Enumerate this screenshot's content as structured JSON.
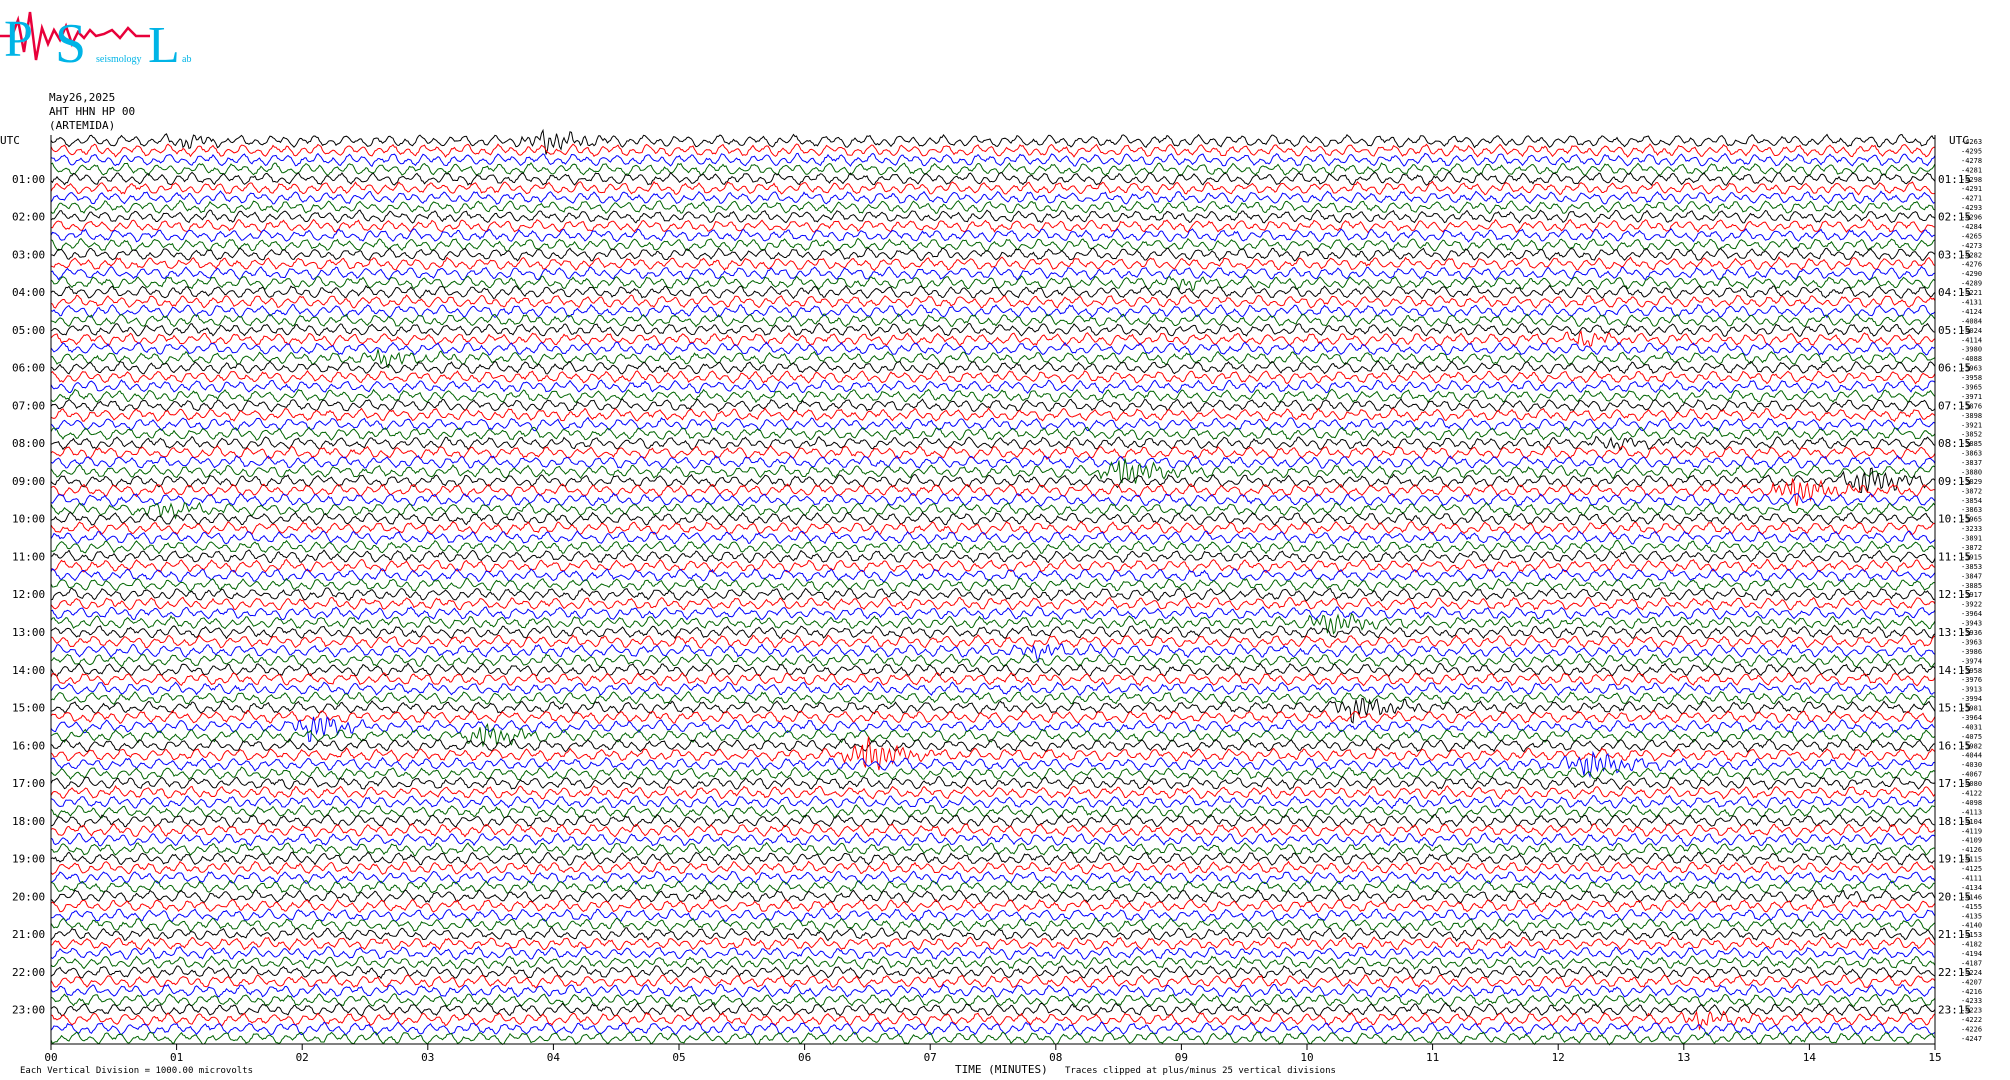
{
  "logo": {
    "big_letters": [
      "P",
      "S",
      "L"
    ],
    "small_words": [
      "seismology",
      "ab"
    ],
    "colors": {
      "letters": "#00b4e6",
      "trace": "#e8003a"
    }
  },
  "header": {
    "date": "May26,2025",
    "channel": "AHT HHN HP 00",
    "station": "(ARTEMIDA)"
  },
  "footer": {
    "scale_note": "Each Vertical Division = 1000.00 microvolts",
    "xlabel": "TIME (MINUTES)",
    "clip_note": "Traces clipped at plus/minus 25 vertical divisions"
  },
  "chart_data": {
    "type": "line",
    "title": "",
    "xlabel": "TIME (MINUTES)",
    "xlim": [
      0,
      15
    ],
    "x_ticks": [
      "00",
      "01",
      "02",
      "03",
      "04",
      "05",
      "06",
      "07",
      "08",
      "09",
      "10",
      "11",
      "12",
      "13",
      "14",
      "15"
    ],
    "left_axis_label": "UTC",
    "right_axis_label": "UTC",
    "left_hour_labels": [
      "01:00",
      "02:00",
      "03:00",
      "04:00",
      "05:00",
      "06:00",
      "07:00",
      "08:00",
      "09:00",
      "10:00",
      "11:00",
      "12:00",
      "13:00",
      "14:00",
      "15:00",
      "16:00",
      "17:00",
      "18:00",
      "19:00",
      "20:00",
      "21:00",
      "22:00",
      "23:00"
    ],
    "right_hour_labels": [
      "01:15",
      "02:15",
      "03:15",
      "04:15",
      "05:15",
      "06:15",
      "07:15",
      "08:15",
      "09:15",
      "10:15",
      "11:15",
      "12:15",
      "13:15",
      "14:15",
      "15:15",
      "16:15",
      "17:15",
      "18:15",
      "19:15",
      "20:15",
      "21:15",
      "22:15",
      "23:15"
    ],
    "trace_count": 96,
    "trace_colors": [
      "#000000",
      "#ff0000",
      "#0000ff",
      "#006400"
    ],
    "right_offsets": [
      -4263,
      -4295,
      -4278,
      -4281,
      -4298,
      -4291,
      -4271,
      -4293,
      -4296,
      -4284,
      -4265,
      -4273,
      -4282,
      -4276,
      -4290,
      -4289,
      -4221,
      -4131,
      -4124,
      -4084,
      -4024,
      -4114,
      -3980,
      -4088,
      -3963,
      -3958,
      -3965,
      -3971,
      -3876,
      -3898,
      -3921,
      -3852,
      -3885,
      -3863,
      -3837,
      -3880,
      -3829,
      -3872,
      -3854,
      -3863,
      -3965,
      -3233,
      -3891,
      -3872,
      -3915,
      -3853,
      -3847,
      -3885,
      -3917,
      -3922,
      -3964,
      -3943,
      -3936,
      -3963,
      -3986,
      -3974,
      -3958,
      -3976,
      -3913,
      -3994,
      -3981,
      -3964,
      -4031,
      -4075,
      -3982,
      -4044,
      -4030,
      -4067,
      -4080,
      -4122,
      -4098,
      -4113,
      -4104,
      -4119,
      -4109,
      -4126,
      -4115,
      -4125,
      -4111,
      -4134,
      -4146,
      -4155,
      -4135,
      -4140,
      -4153,
      -4182,
      -4194,
      -4187,
      -4224,
      -4207,
      -4216,
      -4233,
      -4223,
      -4222,
      -4226,
      -4247
    ],
    "events": [
      {
        "minute": 3.9,
        "row": 0,
        "amplitude": 1.2
      },
      {
        "minute": 1.05,
        "row": 0,
        "amplitude": 0.6
      },
      {
        "minute": 8.97,
        "row": 15,
        "amplitude": 0.6
      },
      {
        "minute": 12.15,
        "row": 21,
        "amplitude": 0.7
      },
      {
        "minute": 2.6,
        "row": 23,
        "amplitude": 0.8
      },
      {
        "minute": 12.4,
        "row": 32,
        "amplitude": 0.6
      },
      {
        "minute": 8.5,
        "row": 35,
        "amplitude": 1.6
      },
      {
        "minute": 14.4,
        "row": 36,
        "amplitude": 1.6
      },
      {
        "minute": 13.85,
        "row": 37,
        "amplitude": 1.6
      },
      {
        "minute": 0.85,
        "row": 39,
        "amplitude": 0.8
      },
      {
        "minute": 10.15,
        "row": 51,
        "amplitude": 1.2
      },
      {
        "minute": 7.8,
        "row": 54,
        "amplitude": 0.7
      },
      {
        "minute": 10.35,
        "row": 60,
        "amplitude": 1.4
      },
      {
        "minute": 2.05,
        "row": 62,
        "amplitude": 1.4
      },
      {
        "minute": 3.4,
        "row": 63,
        "amplitude": 1.2
      },
      {
        "minute": 6.45,
        "row": 65,
        "amplitude": 2.0
      },
      {
        "minute": 12.2,
        "row": 66,
        "amplitude": 1.5
      },
      {
        "minute": 14.2,
        "row": 80,
        "amplitude": 0.4
      },
      {
        "minute": 13.1,
        "row": 93,
        "amplitude": 0.8
      }
    ]
  }
}
